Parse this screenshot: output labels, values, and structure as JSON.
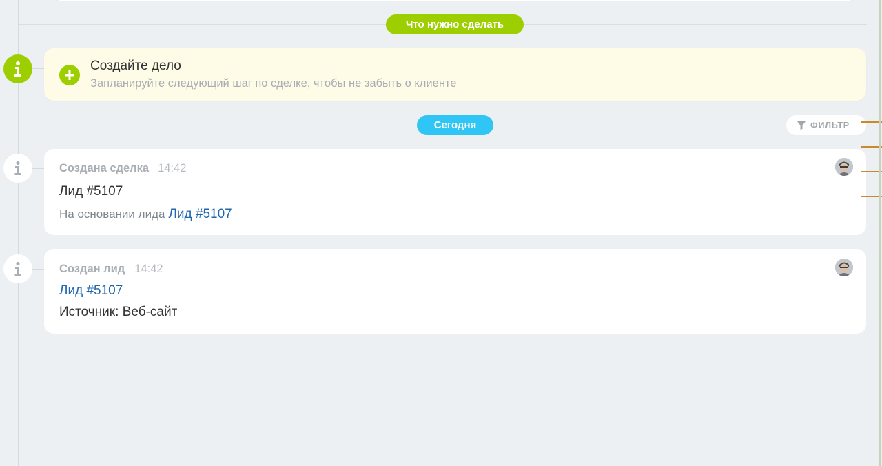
{
  "timeline": {
    "todo_label": "Что нужно сделать",
    "today_label": "Сегодня",
    "filter_label": "ФИЛЬТР"
  },
  "create_task": {
    "title": "Создайте дело",
    "subtitle": "Запланируйте следующий шаг по сделке, чтобы не забыть о клиенте"
  },
  "events": [
    {
      "heading": "Создана сделка",
      "time": "14:42",
      "title": "Лид #5107",
      "basis_text": "На основании лида",
      "basis_link": "Лид #5107"
    },
    {
      "heading": "Создан лид",
      "time": "14:42",
      "link": "Лид #5107",
      "source": "Источник: Веб-сайт"
    }
  ],
  "colors": {
    "accent_green": "#9dcf00",
    "accent_blue": "#2fc6f6",
    "link": "#2067b0",
    "background": "#edf0f3"
  },
  "icons": [
    "info-icon",
    "plus-icon",
    "filter-icon",
    "avatar"
  ]
}
